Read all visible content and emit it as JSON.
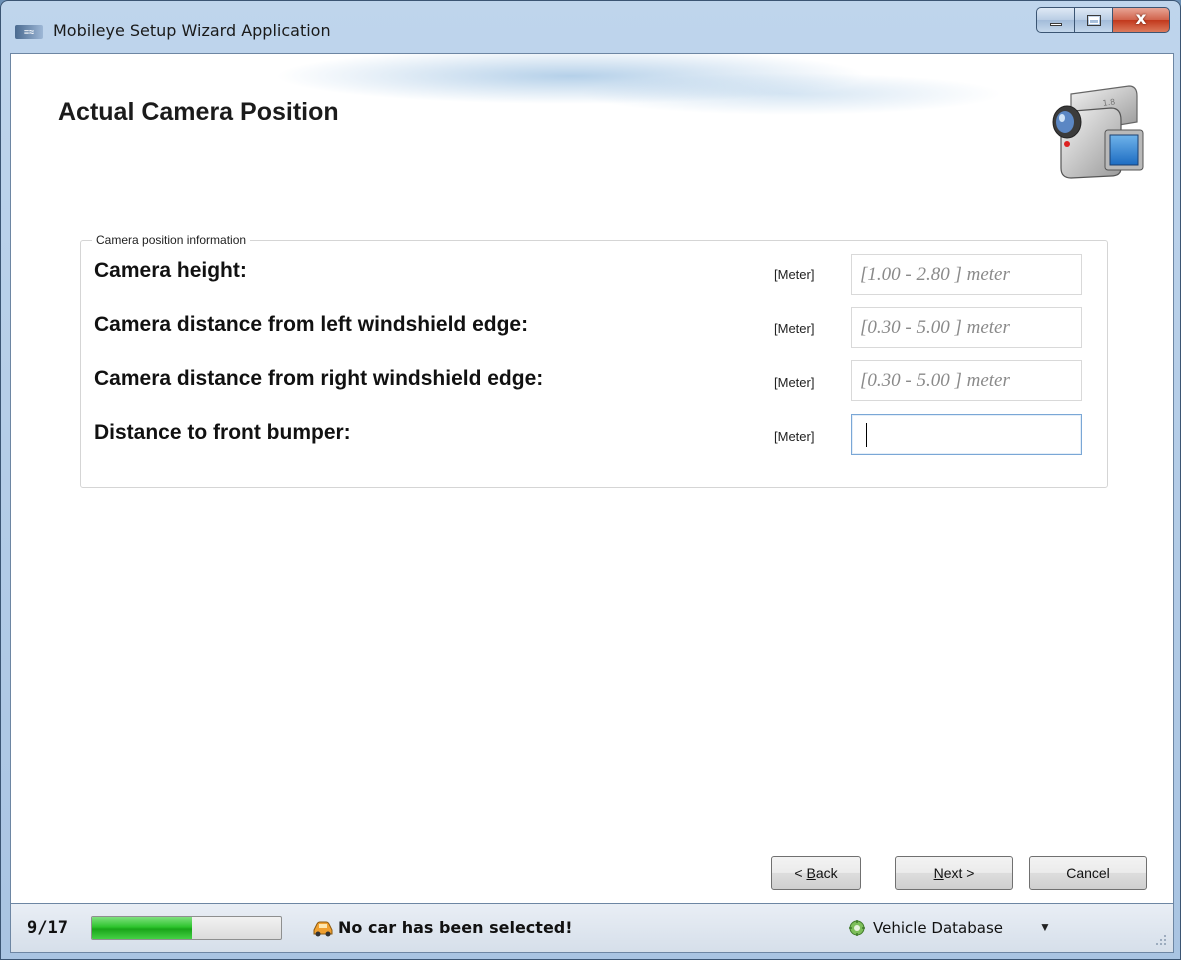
{
  "window": {
    "title": "Mobileye Setup Wizard Application",
    "title_icon_text": "≡≈",
    "close_glyph": "x"
  },
  "page": {
    "title": "Actual Camera Position"
  },
  "group": {
    "legend": "Camera position information",
    "rows": [
      {
        "label": "Camera height:",
        "unit": "[Meter]",
        "placeholder": "[1.00 - 2.80 ] meter",
        "value": ""
      },
      {
        "label": "Camera distance from left windshield edge:",
        "unit": "[Meter]",
        "placeholder": "[0.30 - 5.00 ] meter",
        "value": ""
      },
      {
        "label": "Camera distance from right windshield edge:",
        "unit": "[Meter]",
        "placeholder": "[0.30 - 5.00 ] meter",
        "value": ""
      },
      {
        "label": "Distance to front bumper:",
        "unit": "[Meter]",
        "placeholder": "",
        "value": ""
      }
    ]
  },
  "buttons": {
    "back_prefix": "< ",
    "back_mnemonic": "B",
    "back_rest": "ack",
    "next_mnemonic": "N",
    "next_rest": "ext >",
    "cancel": "Cancel"
  },
  "status": {
    "step": "9/17",
    "progress_fraction": 0.53,
    "car_warning": "No car has been selected!",
    "vehicle_db": "Vehicle Database",
    "db_arrow": "▼"
  },
  "icons": {
    "camera": "camcorder-icon",
    "car_warning": "car-warning-icon",
    "database": "vehicle-database-icon"
  }
}
